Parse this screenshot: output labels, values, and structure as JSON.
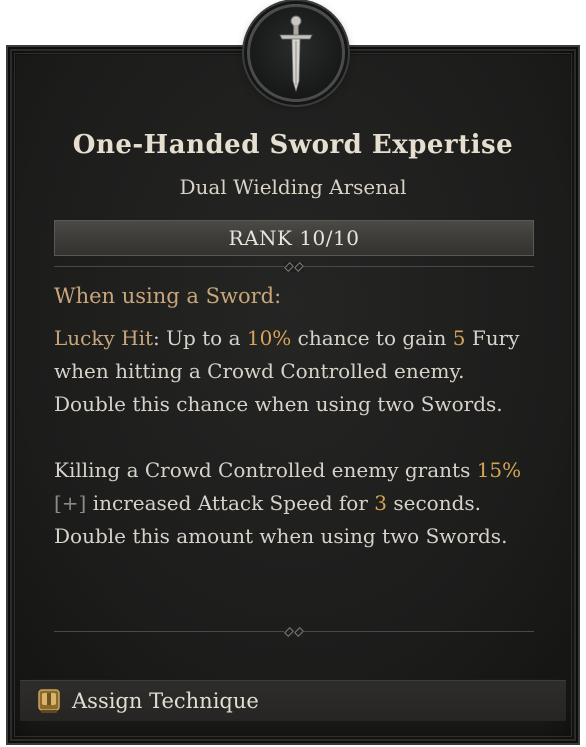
{
  "tooltip": {
    "title": "One-Handed Sword Expertise",
    "subtitle": "Dual Wielding Arsenal",
    "rank": "RANK 10/10",
    "condition": "When using a Sword:",
    "paragraph1": {
      "lucky_hit": "Lucky Hit",
      "t1": ": Up to a ",
      "pct": "10%",
      "t2": " chance to gain ",
      "fury_amount": "5",
      "t3": " Fury when hitting a Crowd Controlled enemy. Double this chance when using two Swords."
    },
    "paragraph2": {
      "t1": "Killing a Crowd Controlled enemy grants ",
      "pct": "15%",
      "plus": "[+]",
      "t2": " increased Attack Speed for ",
      "seconds": "3",
      "t3": " seconds. Double this amount when using two Swords."
    }
  },
  "footer": {
    "action_label": "Assign Technique",
    "icon": "keybind-icon"
  },
  "emblem": {
    "icon": "sword-icon"
  },
  "colors": {
    "gold": "#d4a458",
    "tan": "#c9a67a",
    "text": "#d7d3cb",
    "background": "#1b1b1a"
  }
}
